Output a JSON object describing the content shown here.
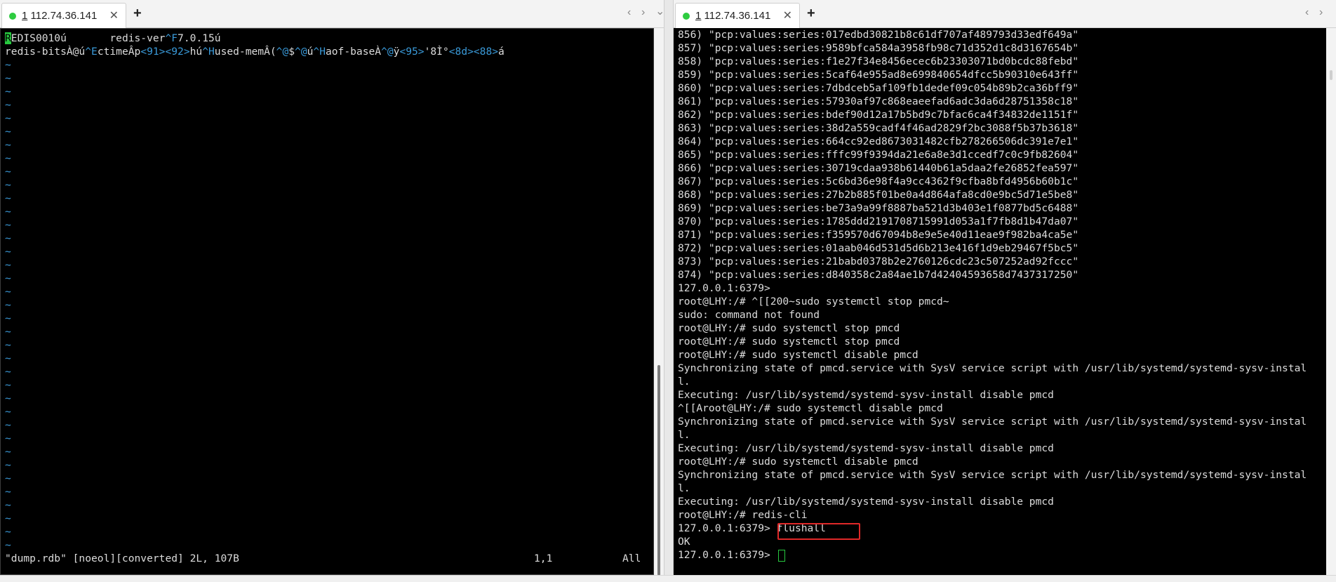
{
  "left_tab": {
    "number": "1",
    "title": " 112.74.36.141",
    "close": "✕",
    "new_tab": "+"
  },
  "right_tab": {
    "number": "1",
    "title": " 112.74.36.141",
    "close": "✕",
    "new_tab": "+"
  },
  "nav": {
    "prev": "‹",
    "next": "›",
    "menu": "⌄"
  },
  "vim": {
    "line1_a": "R",
    "line1_b": "EDIS0010ú\t redis-ver",
    "line1_c": "^F",
    "line1_d": "7.0.15ú",
    "line2_a": "redis-bitsÀ@ú",
    "line2_b": "^E",
    "line2_c": "ctimeÂp",
    "line2_d": "<91><92>",
    "line2_e": "hú",
    "line2_f": "^H",
    "line2_g": "used-memÂ(",
    "line2_h": "^@",
    "line2_i": "$",
    "line2_j": "^@",
    "line2_k": "ú",
    "line2_l": "^H",
    "line2_m": "aof-baseÀ",
    "line2_n": "^@",
    "line2_o": "ÿ",
    "line2_p": "<95>",
    "line2_q": "'8Ì°",
    "line2_r": "<8d><88>",
    "line2_s": "á",
    "tilde": "~",
    "status_file": "\"dump.rdb\" [noeol][converted] 2L, 107B",
    "status_pos": "1,1",
    "status_all": "All"
  },
  "terminal_lines": [
    "856) \"pcp:values:series:017edbd30821b8c61df707af489793d33edf649a\"",
    "857) \"pcp:values:series:9589bfca584a3958fb98c71d352d1c8d3167654b\"",
    "858) \"pcp:values:series:f1e27f34e8456ecec6b23303071bd0bcdc88febd\"",
    "859) \"pcp:values:series:5caf64e955ad8e699840654dfcc5b90310e643ff\"",
    "860) \"pcp:values:series:7dbdceb5af109fb1dedef09c054b89b2ca36bff9\"",
    "861) \"pcp:values:series:57930af97c868eaeefad6adc3da6d28751358c18\"",
    "862) \"pcp:values:series:bdef90d12a17b5bd9c7bfac6ca4f34832de1151f\"",
    "863) \"pcp:values:series:38d2a559cadf4f46ad2829f2bc3088f5b37b3618\"",
    "864) \"pcp:values:series:664cc92ed8673031482cfb278266506dc391e7e1\"",
    "865) \"pcp:values:series:fffc99f9394da21e6a8e3d1ccedf7c0c9fb82604\"",
    "866) \"pcp:values:series:30719cdaa938b61440b61a5daa2fe26852fea597\"",
    "867) \"pcp:values:series:5c6bd36e98f4a9cc4362f9cfba8bfd4956b60b1c\"",
    "868) \"pcp:values:series:27b2b885f01be0a4d864afa8cd0e9bc5d71e5be8\"",
    "869) \"pcp:values:series:be73a9a99f8887ba521d3b403e1f0877bd5c6488\"",
    "870) \"pcp:values:series:1785ddd2191708715991d053a1f7fb8d1b47da07\"",
    "871) \"pcp:values:series:f359570d67094b8e9e5e40d11eae9f982ba4ca5e\"",
    "872) \"pcp:values:series:01aab046d531d5d6b213e416f1d9eb29467f5bc5\"",
    "873) \"pcp:values:series:21babd0378b2e2760126cdc23c507252ad92fccc\"",
    "874) \"pcp:values:series:d840358c2a84ae1b7d42404593658d7437317250\"",
    "127.0.0.1:6379>",
    "root@LHY:/# ^[[200~sudo systemctl stop pmcd~",
    "sudo: command not found",
    "root@LHY:/# sudo systemctl stop pmcd",
    "root@LHY:/# sudo systemctl stop pmcd",
    "root@LHY:/# sudo systemctl disable pmcd",
    "Synchronizing state of pmcd.service with SysV service script with /usr/lib/systemd/systemd-sysv-instal",
    "l.",
    "Executing: /usr/lib/systemd/systemd-sysv-install disable pmcd",
    "^[[Aroot@LHY:/# sudo systemctl disable pmcd",
    "Synchronizing state of pmcd.service with SysV service script with /usr/lib/systemd/systemd-sysv-instal",
    "l.",
    "Executing: /usr/lib/systemd/systemd-sysv-install disable pmcd",
    "root@LHY:/# sudo systemctl disable pmcd",
    "Synchronizing state of pmcd.service with SysV service script with /usr/lib/systemd/systemd-sysv-instal",
    "l.",
    "Executing: /usr/lib/systemd/systemd-sysv-install disable pmcd",
    "root@LHY:/# redis-cli"
  ],
  "redis_prompt": "127.0.0.1:6379> ",
  "flush_cmd": "flushall",
  "ok": "OK",
  "final_prompt": "127.0.0.1:6379> "
}
